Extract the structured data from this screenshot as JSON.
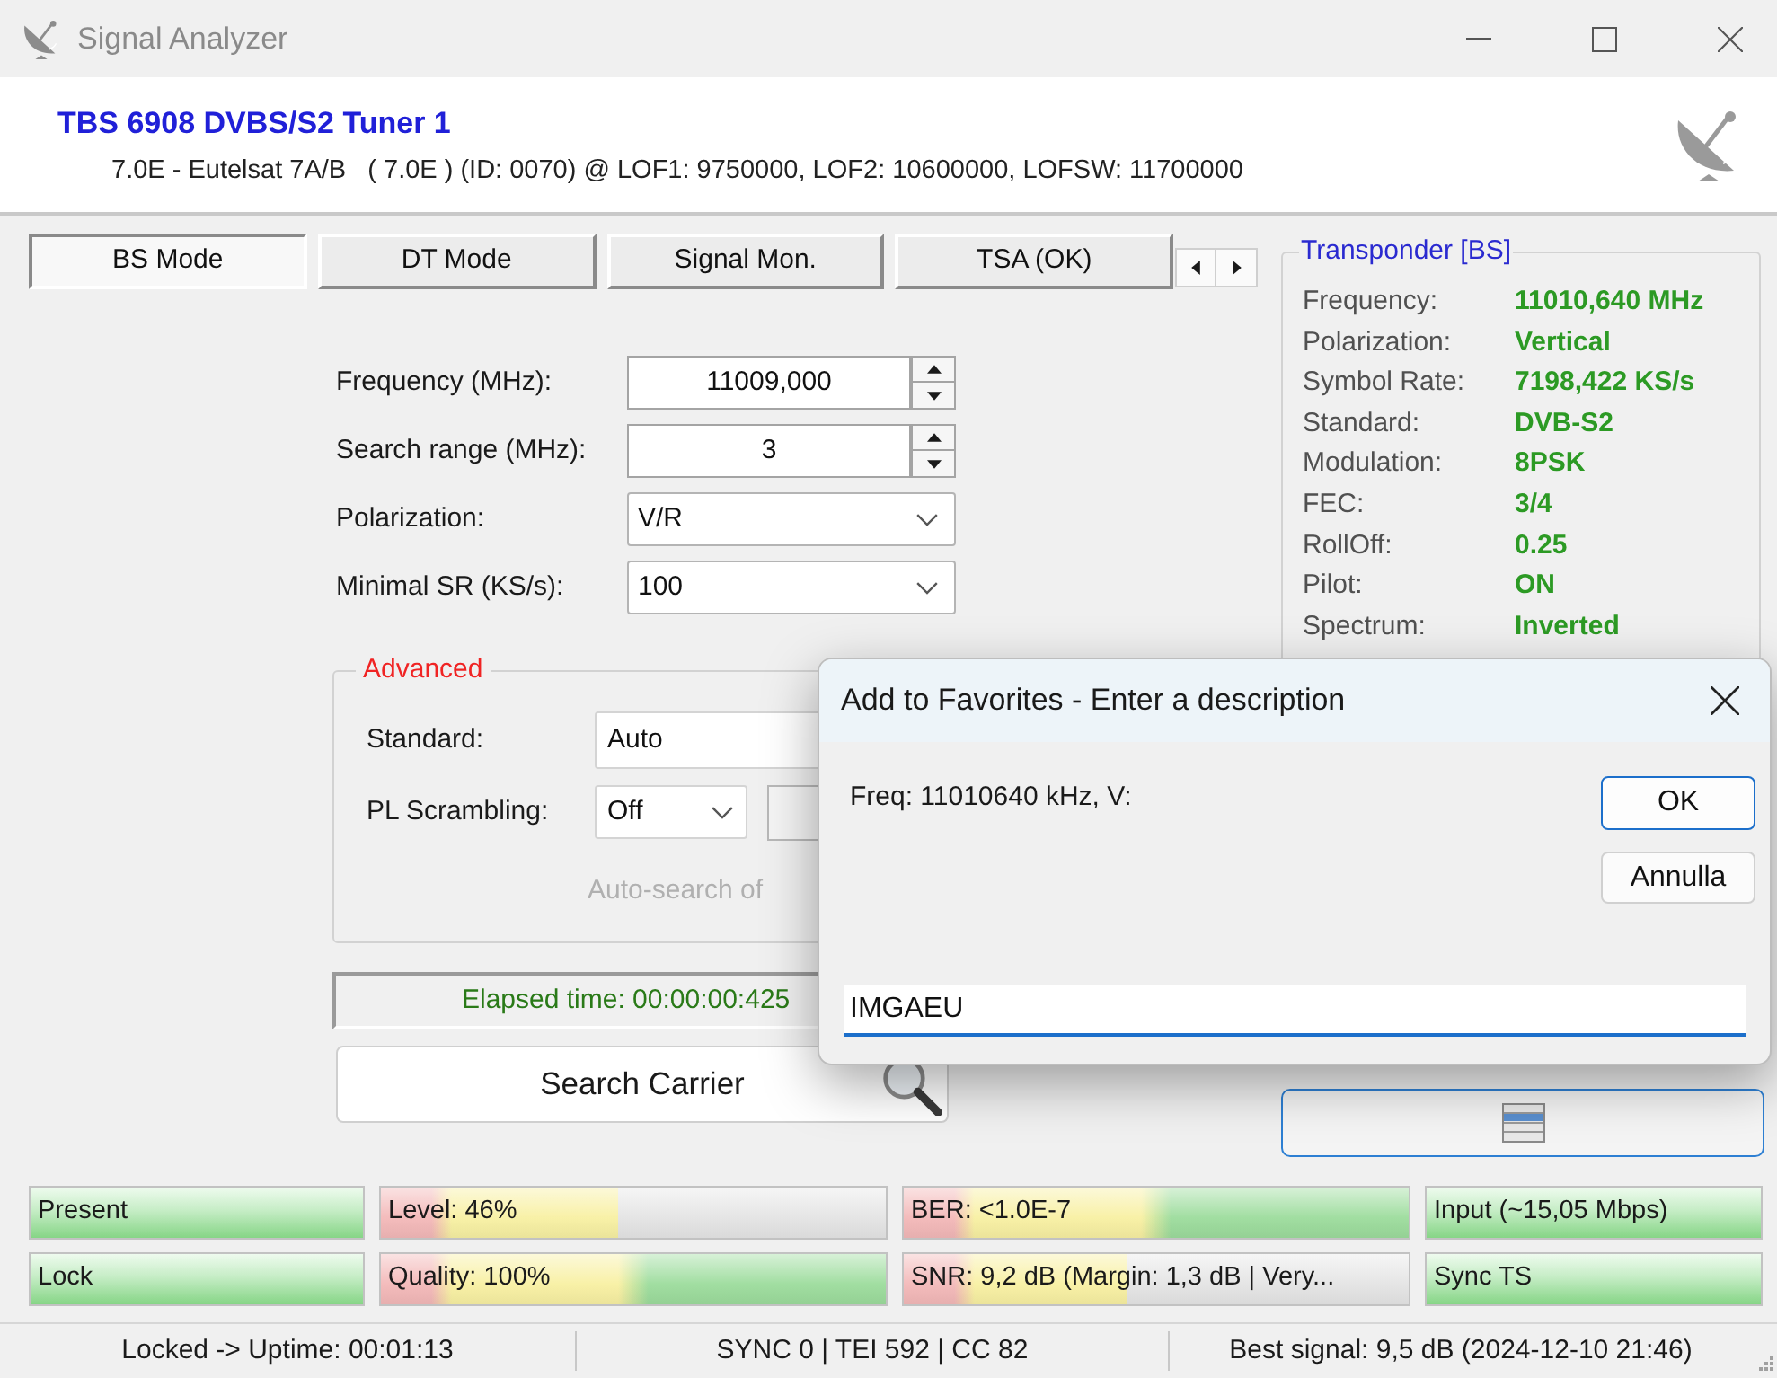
{
  "window": {
    "title": "Signal Analyzer"
  },
  "header": {
    "device": "TBS 6908 DVBS/S2 Tuner 1",
    "details": "7.0E - Eutelsat 7A/B   ( 7.0E ) (ID: 0070) @ LOF1: 9750000, LOF2: 10600000, LOFSW: 11700000"
  },
  "tabs": [
    {
      "label": "BS Mode",
      "selected": true
    },
    {
      "label": "DT Mode",
      "selected": false
    },
    {
      "label": "Signal Mon.",
      "selected": false
    },
    {
      "label": "TSA (OK)",
      "selected": false
    }
  ],
  "form": {
    "fields": [
      {
        "label": "Frequency (MHz):",
        "value": "11009,000",
        "kind": "spin"
      },
      {
        "label": "Search range (MHz):",
        "value": "3",
        "kind": "spin"
      },
      {
        "label": "Polarization:",
        "value": "V/R",
        "kind": "dropdown"
      },
      {
        "label": "Minimal SR (KS/s):",
        "value": "100",
        "kind": "dropdown"
      }
    ]
  },
  "advanced": {
    "title": "Advanced",
    "standard": {
      "label": "Standard:",
      "value": "Auto"
    },
    "pl_scrambling": {
      "label": "PL Scrambling:",
      "value": "Off"
    },
    "note": "Auto-search of"
  },
  "elapsed": "Elapsed time: 00:00:00:425",
  "search_button": "Search Carrier",
  "transponder": {
    "title": "Transponder [BS]",
    "rows": [
      {
        "label": "Frequency:",
        "value": "11010,640 MHz"
      },
      {
        "label": "Polarization:",
        "value": "Vertical"
      },
      {
        "label": "Symbol Rate:",
        "value": "7198,422 KS/s"
      },
      {
        "label": "Standard:",
        "value": "DVB-S2"
      },
      {
        "label": "Modulation:",
        "value": "8PSK"
      },
      {
        "label": "FEC:",
        "value": "3/4"
      },
      {
        "label": "RollOff:",
        "value": "0.25"
      },
      {
        "label": "Pilot:",
        "value": "ON"
      },
      {
        "label": "Spectrum:",
        "value": "Inverted"
      }
    ]
  },
  "meters": [
    {
      "label": "Present",
      "kind": "status",
      "level": 1
    },
    {
      "label": "Level: 46%",
      "kind": "graded",
      "level": 0.47
    },
    {
      "label": "BER: <1.0E-7",
      "kind": "graded",
      "level": 1
    },
    {
      "label": "Input (~15,05 Mbps)",
      "kind": "status",
      "level": 1
    },
    {
      "label": "Lock",
      "kind": "status",
      "level": 1
    },
    {
      "label": "Quality: 100%",
      "kind": "graded",
      "level": 1
    },
    {
      "label": "SNR: 9,2 dB (Margin: 1,3 dB | Very...",
      "kind": "graded",
      "level": 0.44
    },
    {
      "label": "Sync TS",
      "kind": "status",
      "level": 1
    }
  ],
  "status_bar": [
    "Locked -> Uptime: 00:01:13",
    "SYNC 0 | TEI 592 | CC 82",
    "Best signal: 9,5 dB (2024-12-10 21:46)"
  ],
  "dialog": {
    "title": "Add to Favorites - Enter a description",
    "message": "Freq: 11010640 kHz, V:",
    "value": "IMGAEU",
    "buttons": [
      {
        "label": "OK",
        "kind": "default"
      },
      {
        "label": "Annulla",
        "kind": "normal"
      }
    ]
  }
}
